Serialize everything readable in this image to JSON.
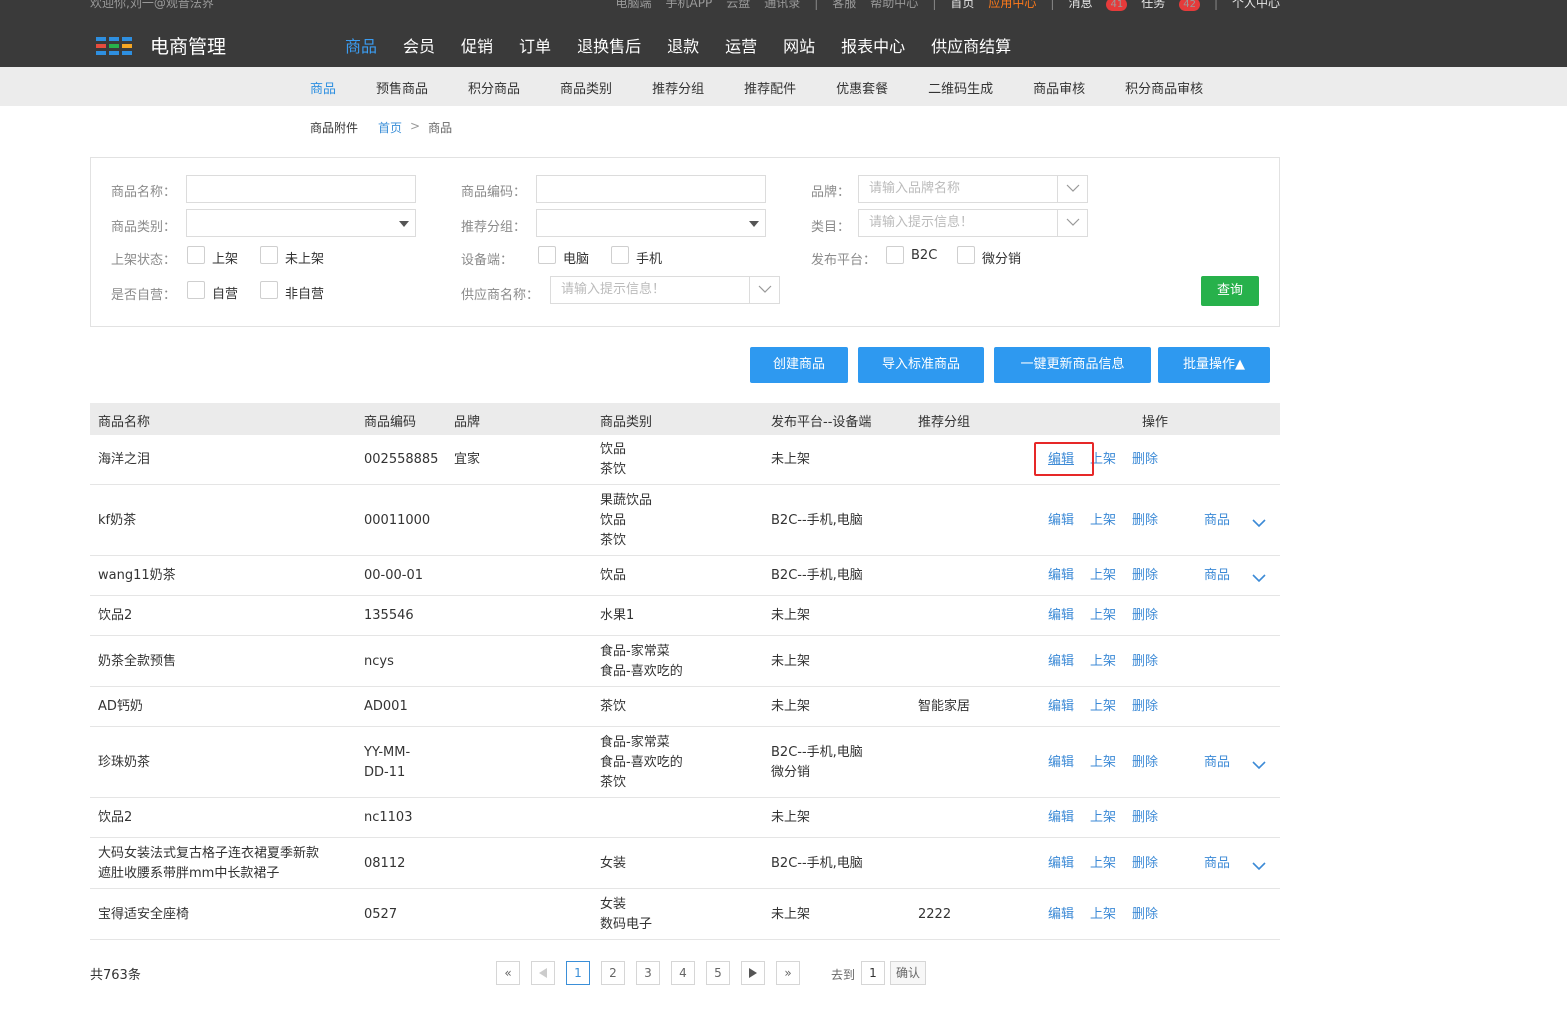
{
  "header": {
    "welcome": "欢迎你,刘一@观音法界",
    "links": [
      "电脑端",
      "手机APP",
      "云盘",
      "通讯录",
      "客服",
      "帮助中心",
      "首页",
      "应用中心",
      "消息",
      "任务",
      "个人中心"
    ],
    "messages_count": "41",
    "tasks_count": "42",
    "app_title": "电商管理",
    "logo_colors": [
      "#2e8fe0",
      "#2e8fe0",
      "#2e8fe0",
      "#e84c3d",
      "#27b14b",
      "#f5a623",
      "#2e8fe0",
      "#2e8fe0",
      "#2e8fe0"
    ]
  },
  "main_nav": [
    "商品",
    "会员",
    "促销",
    "订单",
    "退换售后",
    "退款",
    "运营",
    "网站",
    "报表中心",
    "供应商结算"
  ],
  "sub_nav": [
    "商品",
    "预售商品",
    "积分商品",
    "商品类别",
    "推荐分组",
    "推荐配件",
    "优惠套餐",
    "二维码生成",
    "商品审核",
    "积分商品审核"
  ],
  "breadcrumb": {
    "attach": "商品附件",
    "home": "首页",
    "sep": ">",
    "current": "商品"
  },
  "filter": {
    "name_label": "商品名称：",
    "code_label": "商品编码：",
    "brand_label": "品牌：",
    "brand_placeholder": "请输入品牌名称",
    "category_label": "商品类别：",
    "group_label": "推荐分组：",
    "class_label": "类目：",
    "class_placeholder": "请输入提示信息！",
    "status_label": "上架状态：",
    "status_on": "上架",
    "status_off": "未上架",
    "device_label": "设备端：",
    "device_pc": "电脑",
    "device_mobile": "手机",
    "platform_label": "发布平台：",
    "platform_b2c": "B2C",
    "platform_micro": "微分销",
    "self_label": "是否自营：",
    "self_yes": "自营",
    "self_no": "非自营",
    "supplier_label": "供应商名称：",
    "supplier_placeholder": "请输入提示信息！",
    "query": "查询"
  },
  "actions": {
    "create": "创建商品",
    "import": "导入标准商品",
    "update": "一键更新商品信息",
    "batch": "批量操作▲"
  },
  "table": {
    "headers": {
      "name": "商品名称",
      "code": "商品编码",
      "brand": "品牌",
      "category": "商品类别",
      "platform": "发布平台--设备端",
      "group": "推荐分组",
      "ops": "操作"
    },
    "op_edit": "编辑",
    "op_shelf": "上架",
    "op_delete": "删除",
    "op_product": "商品",
    "rows": [
      {
        "name": [
          "海洋之泪"
        ],
        "code": [
          "002558885"
        ],
        "brand": "宜家",
        "category": [
          "饮品",
          "茶饮"
        ],
        "platform": [
          "未上架"
        ],
        "group": "",
        "product": false
      },
      {
        "name": [
          "kf奶茶"
        ],
        "code": [
          "00011000"
        ],
        "brand": "",
        "category": [
          "果蔬饮品",
          "饮品",
          "茶饮"
        ],
        "platform": [
          "B2C--手机,电脑"
        ],
        "group": "",
        "product": true
      },
      {
        "name": [
          "wang11奶茶"
        ],
        "code": [
          "00-00-01"
        ],
        "brand": "",
        "category": [
          "饮品"
        ],
        "platform": [
          "B2C--手机,电脑"
        ],
        "group": "",
        "product": true
      },
      {
        "name": [
          "饮品2"
        ],
        "code": [
          "135546"
        ],
        "brand": "",
        "category": [
          "水果1"
        ],
        "platform": [
          "未上架"
        ],
        "group": "",
        "product": false
      },
      {
        "name": [
          "奶茶全款预售"
        ],
        "code": [
          "ncys"
        ],
        "brand": "",
        "category": [
          "食品-家常菜",
          "食品-喜欢吃的"
        ],
        "platform": [
          "未上架"
        ],
        "group": "",
        "product": false
      },
      {
        "name": [
          "AD钙奶"
        ],
        "code": [
          "AD001"
        ],
        "brand": "",
        "category": [
          "茶饮"
        ],
        "platform": [
          "未上架"
        ],
        "group": "智能家居",
        "product": false
      },
      {
        "name": [
          "珍珠奶茶"
        ],
        "code": [
          "YY-MM-",
          "DD-11"
        ],
        "brand": "",
        "category": [
          "食品-家常菜",
          "食品-喜欢吃的",
          "茶饮"
        ],
        "platform": [
          "B2C--手机,电脑",
          "微分销"
        ],
        "group": "",
        "product": true
      },
      {
        "name": [
          "饮品2"
        ],
        "code": [
          "nc1103"
        ],
        "brand": "",
        "category": [],
        "platform": [
          "未上架"
        ],
        "group": "",
        "product": false
      },
      {
        "name": [
          "大码女装法式复古格子连衣裙夏季新款",
          "遮肚收腰系带胖mm中长款裙子"
        ],
        "code": [
          "08112"
        ],
        "brand": "",
        "category": [
          "女装"
        ],
        "platform": [
          "B2C--手机,电脑"
        ],
        "group": "",
        "product": true
      },
      {
        "name": [
          "宝得适安全座椅"
        ],
        "code": [
          "0527"
        ],
        "brand": "",
        "category": [
          "女装",
          "数码电子"
        ],
        "platform": [
          "未上架"
        ],
        "group": "2222",
        "product": false
      }
    ]
  },
  "pagination": {
    "total": "共763条",
    "first": "«",
    "last": "»",
    "pages": [
      "1",
      "2",
      "3",
      "4",
      "5"
    ],
    "current": "1",
    "goto_label": "去到",
    "goto_value": "1",
    "confirm": "确认"
  }
}
